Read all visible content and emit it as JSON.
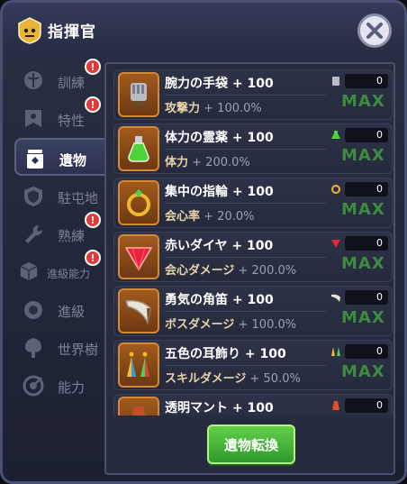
{
  "title": "指揮官",
  "sidebar": {
    "items": [
      {
        "label": "訓練",
        "icon": "brain-icon",
        "badge": "!"
      },
      {
        "label": "特性",
        "icon": "banner-icon",
        "badge": "!"
      },
      {
        "label": "遺物",
        "icon": "relic-jar-icon",
        "badge": ""
      },
      {
        "label": "駐屯地",
        "icon": "shield-icon",
        "badge": ""
      },
      {
        "label": "熟練",
        "icon": "wrench-icon",
        "badge": "!"
      },
      {
        "label": "進級能力",
        "icon": "cube-icon",
        "badge": "!"
      },
      {
        "label": "進級",
        "icon": "medal-icon",
        "badge": ""
      },
      {
        "label": "世界樹",
        "icon": "tree-icon",
        "badge": ""
      },
      {
        "label": "能力",
        "icon": "target-icon",
        "badge": ""
      }
    ]
  },
  "relics": [
    {
      "name": "腕力の手袋 + 100",
      "stat": "攻撃力",
      "value": "+ 100.0%",
      "count": "0",
      "status": "MAX",
      "icon": "gauntlet-icon"
    },
    {
      "name": "体力の霊薬 + 100",
      "stat": "体力",
      "value": "+ 200.0%",
      "count": "0",
      "status": "MAX",
      "icon": "potion-icon"
    },
    {
      "name": "集中の指輪 + 100",
      "stat": "会心率",
      "value": "+ 20.0%",
      "count": "0",
      "status": "MAX",
      "icon": "ring-icon"
    },
    {
      "name": "赤いダイヤ + 100",
      "stat": "会心ダメージ",
      "value": "+ 200.0%",
      "count": "0",
      "status": "MAX",
      "icon": "red-diamond-icon"
    },
    {
      "name": "勇気の角笛 + 100",
      "stat": "ボスダメージ",
      "value": "+ 100.0%",
      "count": "0",
      "status": "MAX",
      "icon": "horn-icon"
    },
    {
      "name": "五色の耳飾り + 100",
      "stat": "スキルダメージ",
      "value": "+ 50.0%",
      "count": "0",
      "status": "MAX",
      "icon": "earring-icon"
    },
    {
      "name": "透明マント + 100",
      "stat": "",
      "value": "",
      "count": "0",
      "status": "",
      "icon": "cloak-icon"
    }
  ],
  "convert_button": "遺物転換",
  "colors": {
    "accent_green": "#3c8c40",
    "badge_red": "#e23a3a",
    "relic_frame": "#d08a3a"
  }
}
